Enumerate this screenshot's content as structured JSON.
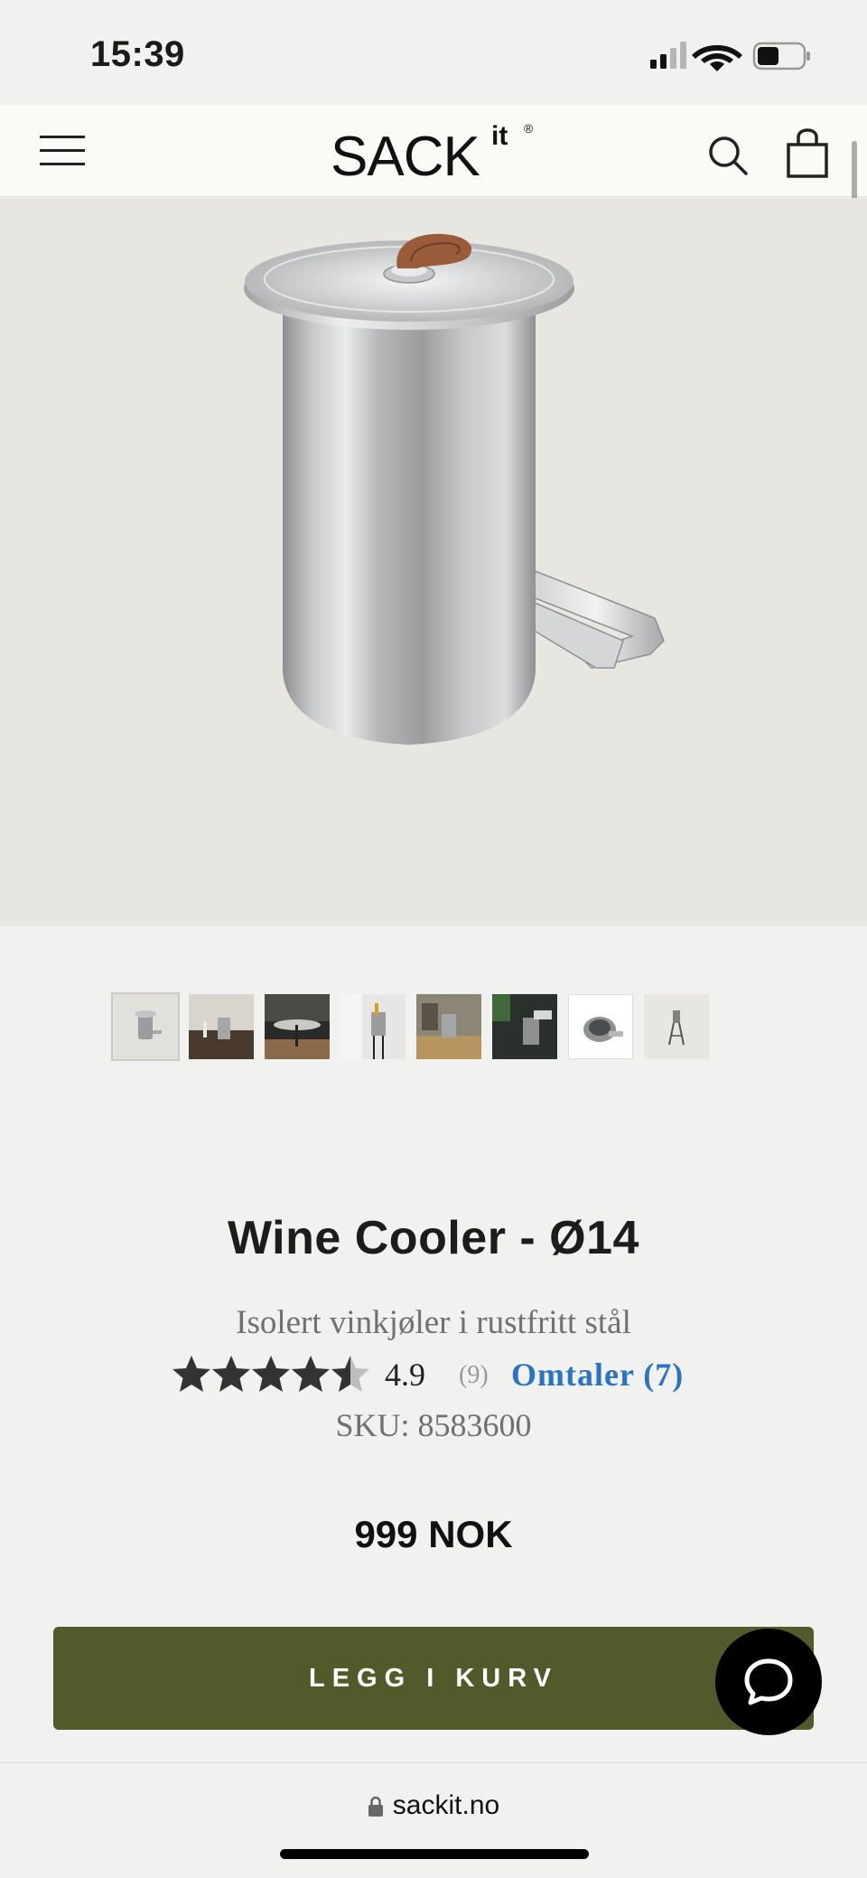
{
  "status_bar": {
    "time": "15:39",
    "icons": [
      "cellular-signal-icon",
      "wifi-icon",
      "battery-icon"
    ]
  },
  "header": {
    "logo_main": "SACK",
    "logo_superscript": "it",
    "logo_registered": "®",
    "icons": [
      "hamburger-menu-icon",
      "search-icon",
      "shopping-bag-icon"
    ]
  },
  "gallery": {
    "thumbnail_count": 8,
    "active_index": 0
  },
  "product": {
    "title": "Wine Cooler - Ø14",
    "subtitle": "Isolert vinkjøler i rustfritt stål",
    "rating_value": "4.9",
    "rating_stars": 4.5,
    "rating_count": "(9)",
    "reviews_link": "Omtaler (7)",
    "sku": "SKU: 8583600",
    "price": "999 NOK"
  },
  "actions": {
    "add_to_cart": "LEGG I KURV"
  },
  "browser": {
    "url": "sackit.no"
  },
  "colors": {
    "accent_green": "#52592a",
    "link_blue": "#2b74c2",
    "page_bg": "#f1f1ef",
    "hero_bg": "#e8e6e1"
  }
}
